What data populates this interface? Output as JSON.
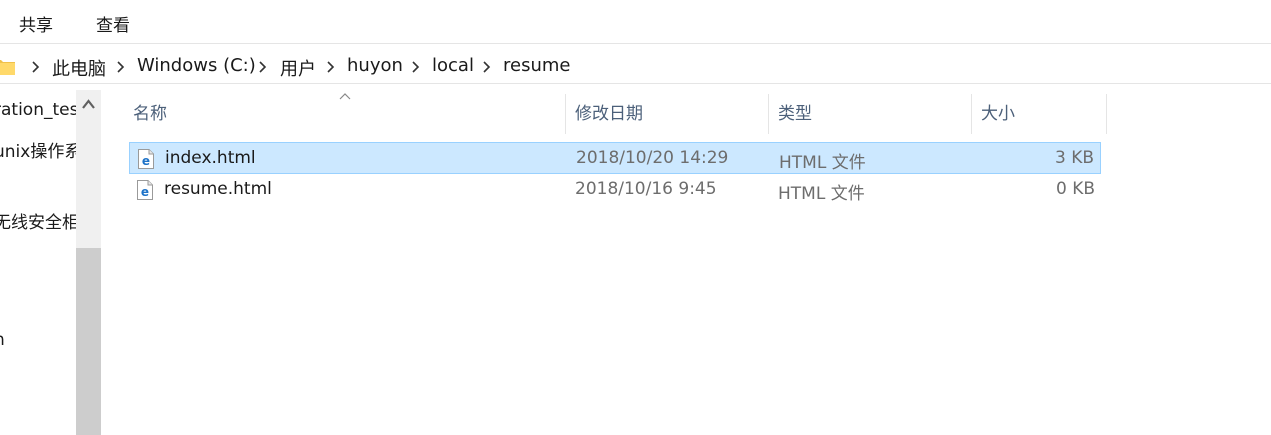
{
  "ribbon": {
    "tabs": [
      "共享",
      "查看"
    ]
  },
  "breadcrumb": [
    "此电脑",
    "Windows (C:)",
    "用户",
    "huyon",
    "local",
    "resume"
  ],
  "nav_pane": {
    "items": [
      "ration_tes",
      "unix操作系",
      "无线安全相",
      "n"
    ]
  },
  "columns": {
    "name": "名称",
    "modified": "修改日期",
    "type": "类型",
    "size": "大小"
  },
  "files": [
    {
      "name": "index.html",
      "modified": "2018/10/20 14:29",
      "type": "HTML 文件",
      "size": "3 KB",
      "selected": true,
      "icon": "edge-html-file-icon"
    },
    {
      "name": "resume.html",
      "modified": "2018/10/16 9:45",
      "type": "HTML 文件",
      "size": "0 KB",
      "selected": false,
      "icon": "edge-html-file-icon"
    }
  ],
  "colors": {
    "selection": "#cce8ff",
    "selection_border": "#99d1ff",
    "header_text": "#4c607a",
    "edge_blue": "#1e73c8"
  }
}
